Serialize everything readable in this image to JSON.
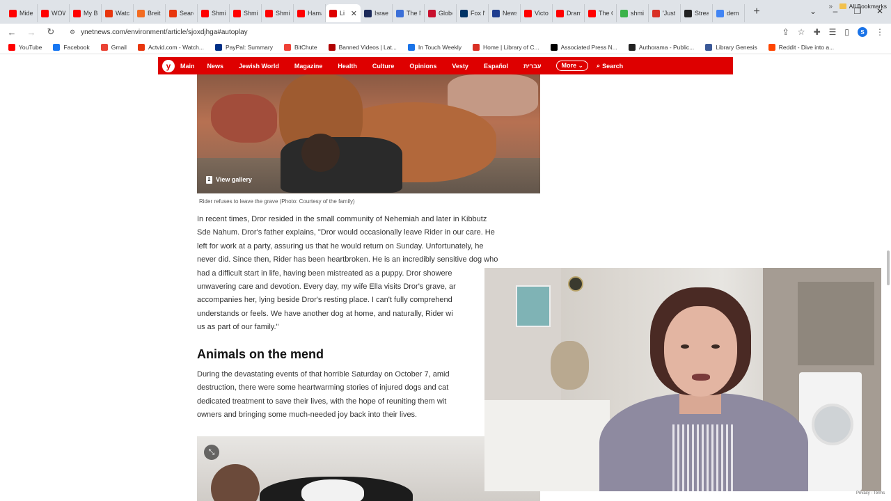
{
  "browser": {
    "tabs": [
      {
        "label": "Mide",
        "icon": "youtube-icon",
        "color": "#ff0000"
      },
      {
        "label": "WOW",
        "icon": "youtube-icon",
        "color": "#ff0000"
      },
      {
        "label": "My B",
        "icon": "youtube-icon",
        "color": "#ff0000"
      },
      {
        "label": "Watch",
        "icon": "actvid-icon",
        "color": "#e8360e"
      },
      {
        "label": "Breit",
        "icon": "breitbart-icon",
        "color": "#f36c21"
      },
      {
        "label": "Searc",
        "icon": "search-site-icon",
        "color": "#e8360e"
      },
      {
        "label": "Shmi",
        "icon": "youtube-icon",
        "color": "#ff0000"
      },
      {
        "label": "Shmi",
        "icon": "youtube-icon",
        "color": "#ff0000"
      },
      {
        "label": "Shmi",
        "icon": "youtube-icon",
        "color": "#ff0000"
      },
      {
        "label": "Hama",
        "icon": "youtube-icon",
        "color": "#ff0000"
      },
      {
        "label": "Li",
        "icon": "ynet-icon",
        "color": "#de0000",
        "active": true
      },
      {
        "label": "Israel",
        "icon": "news-icon",
        "color": "#1c2a5a"
      },
      {
        "label": "The N",
        "icon": "news-icon",
        "color": "#3b6fd8"
      },
      {
        "label": "Globe",
        "icon": "globe-icon",
        "color": "#c8102e"
      },
      {
        "label": "Fox N",
        "icon": "fox-icon",
        "color": "#003366"
      },
      {
        "label": "News",
        "icon": "newsmax-icon",
        "color": "#1e3d8f"
      },
      {
        "label": "Victo",
        "icon": "youtube-icon",
        "color": "#ff0000"
      },
      {
        "label": "Dram",
        "icon": "youtube-icon",
        "color": "#ff0000"
      },
      {
        "label": "The C",
        "icon": "youtube-icon",
        "color": "#ff0000"
      },
      {
        "label": "shmi",
        "icon": "play-icon",
        "color": "#3cb34a"
      },
      {
        "label": "'Just",
        "icon": "person-icon",
        "color": "#d93025"
      },
      {
        "label": "Strea",
        "icon": "stream-icon",
        "color": "#222222"
      },
      {
        "label": "dem",
        "icon": "google-icon",
        "color": "#4285f4"
      }
    ],
    "new_tab": "+",
    "url": "ynetnews.com/environment/article/sjoxdjhga#autoplay",
    "bookmarks": [
      {
        "label": "YouTube",
        "color": "#ff0000"
      },
      {
        "label": "Facebook",
        "color": "#1877f2"
      },
      {
        "label": "Gmail",
        "color": "#ea4335"
      },
      {
        "label": "Actvid.com - Watch...",
        "color": "#e8360e"
      },
      {
        "label": "PayPal: Summary",
        "color": "#003087"
      },
      {
        "label": "BitChute",
        "color": "#ef4137"
      },
      {
        "label": "Banned Videos | Lat...",
        "color": "#b00000"
      },
      {
        "label": "In Touch Weekly",
        "color": "#1a73e8"
      },
      {
        "label": "Home | Library of C...",
        "color": "#d93025"
      },
      {
        "label": "Associated Press N...",
        "color": "#000000"
      },
      {
        "label": "Authorama - Public...",
        "color": "#222222"
      },
      {
        "label": "Library Genesis",
        "color": "#3b5998"
      },
      {
        "label": "Reddit - Dive into a...",
        "color": "#ff4500"
      }
    ],
    "bookmarks_more": "»",
    "all_bookmarks": "All Bookmarks",
    "profile_initial": "S"
  },
  "site": {
    "logo": "y",
    "nav": [
      "Main",
      "News",
      "Jewish World",
      "Magazine",
      "Health",
      "Culture",
      "Opinions",
      "Vesty",
      "Español",
      "עברית"
    ],
    "more": "More",
    "search": "Search",
    "accent": "#de0000"
  },
  "article": {
    "gallery_count": "2",
    "gallery_label": "View gallery",
    "caption": "Rider refuses to leave the grave  (Photo: Courtesy of the family)",
    "lines1": [
      "In recent times, Dror resided in the small community of Nehemiah and later in Kibbutz",
      "Sde Nahum. Dror's father explains, \"Dror would occasionally leave Rider in our care. He",
      "left for work at a party, assuring us that he would return on Sunday. Unfortunately, he",
      "never did. Since then, Rider has been heartbroken. He is an incredibly sensitive dog who",
      "had a difficult start in life, having been mistreated as a puppy. Dror showere",
      "unwavering care and devotion. Every day, my wife Ella visits Dror's grave, ar",
      "accompanies her, lying beside Dror's resting place. I can't fully comprehend",
      "understands or feels. We have another dog at home, and naturally, Rider wi",
      "us as part of our family.\""
    ],
    "heading": "Animals on the mend",
    "lines2": [
      "During the devastating events of that horrible Saturday on October 7, amid",
      "destruction, there were some heartwarming stories of injured dogs and cat",
      "dedicated treatment to save their lives, with the hope of reuniting them wit",
      "owners and bringing some much-needed joy back into their lives."
    ]
  },
  "webcam": {
    "privacy": "Privacy - Terms"
  }
}
